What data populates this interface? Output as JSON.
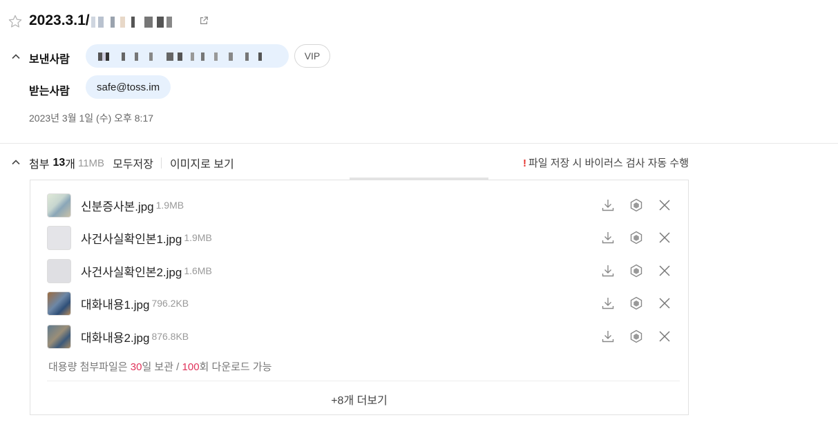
{
  "mail": {
    "subject": "2023.3.1/",
    "sender_label": "보낸사람",
    "sender_badge": "VIP",
    "recipient_label": "받는사람",
    "recipient_email": "safe@toss.im",
    "date": "2023년 3월 1일 (수) 오후 8:17"
  },
  "attachments": {
    "label": "첨부",
    "count": "13",
    "count_unit": "개",
    "total_size": "11MB",
    "save_all": "모두저장",
    "view_images": "이미지로 보기",
    "virus_notice": "파일 저장 시 바이러스 검사 자동 수행",
    "files": [
      {
        "name": "신분증사본.jpg",
        "size": "1.9MB"
      },
      {
        "name": "사건사실확인본1.jpg",
        "size": "1.9MB"
      },
      {
        "name": "사건사실확인본2.jpg",
        "size": "1.6MB"
      },
      {
        "name": "대화내용1.jpg",
        "size": "796.2KB"
      },
      {
        "name": "대화내용2.jpg",
        "size": "876.8KB"
      }
    ],
    "notice_prefix": "대용량 첨부파일은 ",
    "notice_days": "30",
    "notice_mid": "일 보관 / ",
    "notice_downloads": "100",
    "notice_suffix": "회 다운로드 가능",
    "more_label": "+8개 더보기"
  },
  "icons": {
    "star": "star-outline-icon",
    "popout": "external-link-icon",
    "collapse": "chevron-up-icon",
    "download": "download-icon",
    "save_to_drive": "cube-icon",
    "remove": "close-icon"
  },
  "colors": {
    "chip_bg": "#e7f1fd",
    "highlight_number": "#e0335a",
    "warning": "#e5322d"
  }
}
